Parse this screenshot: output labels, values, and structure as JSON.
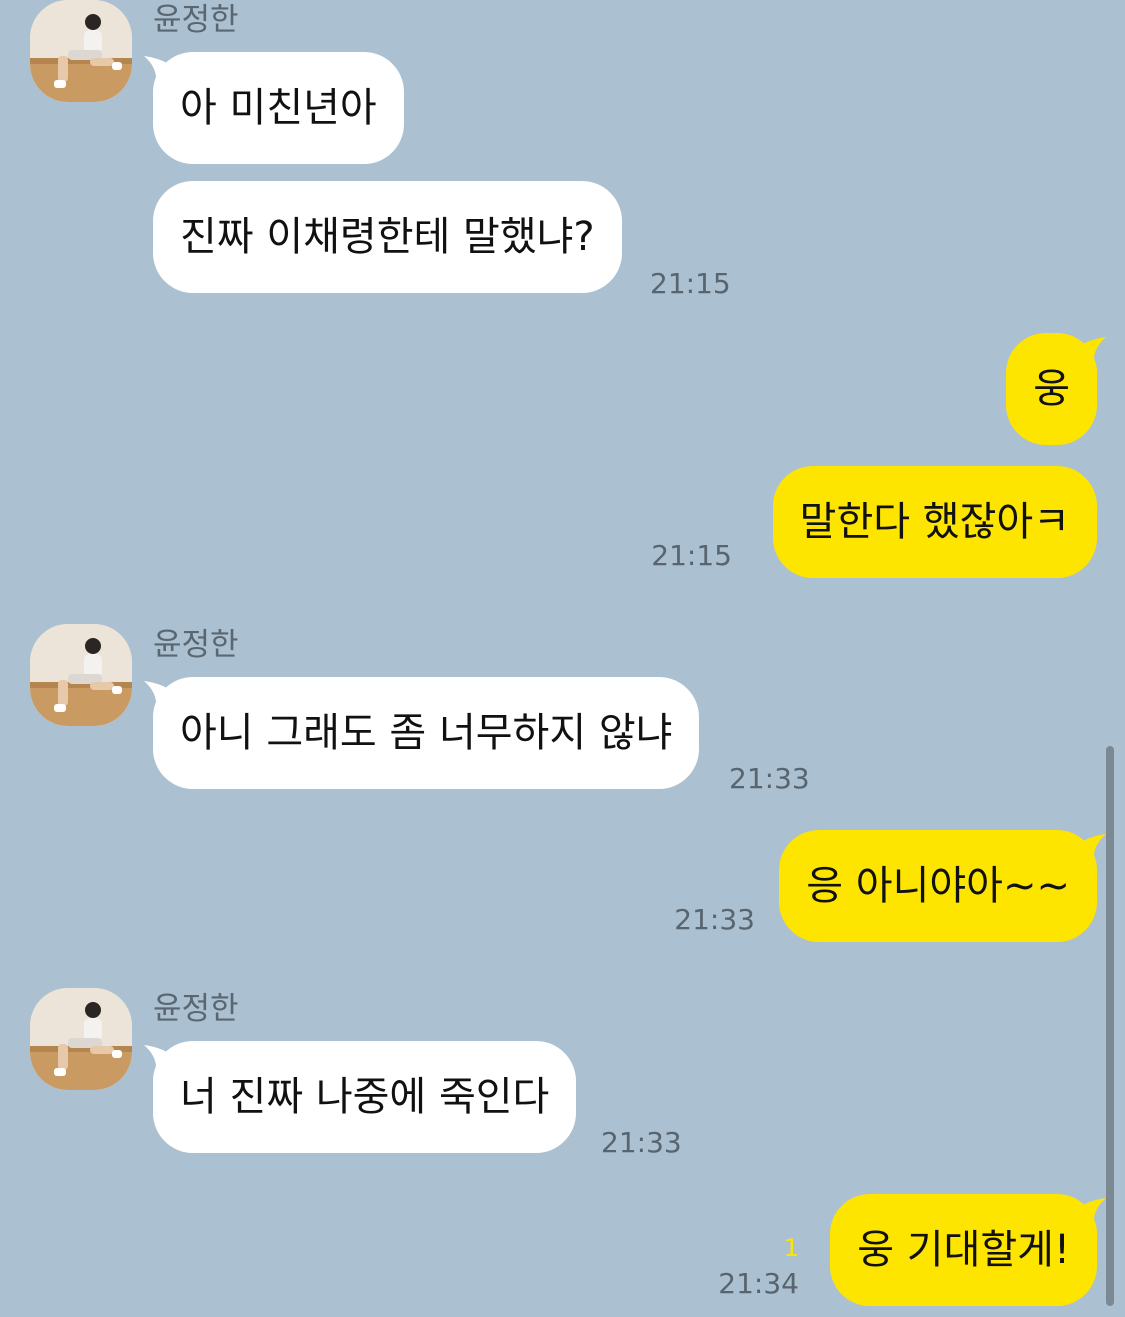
{
  "colors": {
    "background": "#abc1d1",
    "incoming_bubble": "#ffffff",
    "outgoing_bubble": "#fee500",
    "timestamp": "#58646e",
    "sender_name": "#5a6670",
    "unread_count": "#fee500"
  },
  "conversation": {
    "group1": {
      "sender": "윤정한",
      "avatar": "profile-photo",
      "messages": [
        "아 미친년아",
        "진짜 이채령한테 말했냐?"
      ],
      "time": "21:15"
    },
    "reply1": {
      "messages": [
        "웅",
        "말한다 했잖아ㅋ"
      ],
      "time": "21:15"
    },
    "group2": {
      "sender": "윤정한",
      "avatar": "profile-photo",
      "messages": [
        "아니 그래도 좀 너무하지 않냐"
      ],
      "time": "21:33"
    },
    "reply2": {
      "messages": [
        "응 아니야아~~"
      ],
      "time": "21:33"
    },
    "group3": {
      "sender": "윤정한",
      "avatar": "profile-photo",
      "messages": [
        "너 진짜 나중에 죽인다"
      ],
      "time": "21:33"
    },
    "reply3": {
      "messages": [
        "웅 기대할게!"
      ],
      "time": "21:34",
      "unread": "1"
    }
  }
}
